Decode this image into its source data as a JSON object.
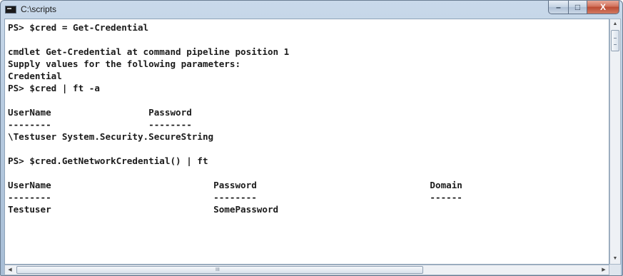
{
  "window": {
    "title": "C:\\scripts",
    "icon": "console-icon",
    "buttons": {
      "minimize_glyph": "–",
      "maximize_glyph": "□",
      "close_glyph": "X"
    }
  },
  "console": {
    "lines": [
      "PS> $cred = Get-Credential",
      "",
      "cmdlet Get-Credential at command pipeline position 1",
      "Supply values for the following parameters:",
      "Credential",
      "PS> $cred | ft -a",
      "",
      "UserName                  Password",
      "--------                  --------",
      "\\Testuser System.Security.SecureString",
      "",
      "PS> $cred.GetNetworkCredential() | ft",
      "",
      "UserName                              Password                                Domain",
      "--------                              --------                                ------",
      "Testuser                              SomePassword"
    ]
  },
  "scrollbars": {
    "up_arrow": "▲",
    "down_arrow": "▼",
    "left_arrow": "◀",
    "right_arrow": "▶",
    "grip": "III"
  },
  "colors": {
    "console_text": "#1b1b1b",
    "console_background": "#ffffff",
    "titlebar": "#b7cbe0",
    "close_button": "#c75a42"
  }
}
